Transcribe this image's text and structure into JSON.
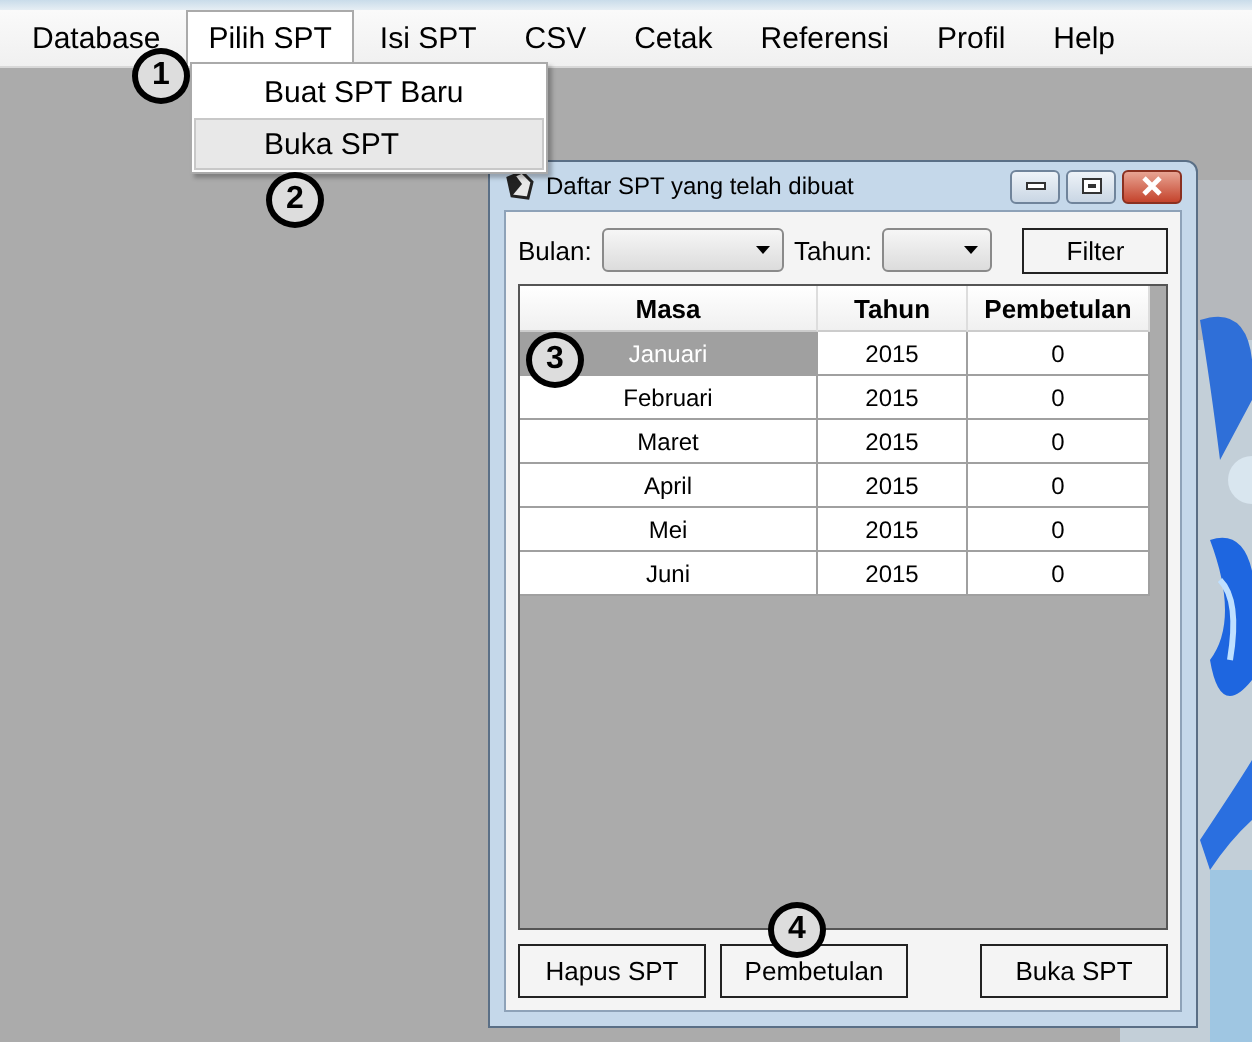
{
  "menu_bar": {
    "items": [
      {
        "label": "Database",
        "selected": false
      },
      {
        "label": "Pilih SPT",
        "selected": true
      },
      {
        "label": "Isi SPT",
        "selected": false
      },
      {
        "label": "CSV",
        "selected": false
      },
      {
        "label": "Cetak",
        "selected": false
      },
      {
        "label": "Referensi",
        "selected": false
      },
      {
        "label": "Profil",
        "selected": false
      },
      {
        "label": "Help",
        "selected": false
      }
    ]
  },
  "dropdown": {
    "items": [
      {
        "label": "Buat SPT Baru",
        "selected": false
      },
      {
        "label": "Buka SPT",
        "selected": true
      }
    ]
  },
  "dialog": {
    "title": "Daftar SPT yang telah dibuat",
    "filters": [
      {
        "label": "Bulan:"
      },
      {
        "label": "Tahun:"
      }
    ],
    "filter_button": "Filter",
    "table": {
      "columns": [
        "Masa",
        "Tahun",
        "Pembetulan"
      ],
      "rows": [
        {
          "cells": [
            "Januari",
            "2015",
            "0"
          ],
          "selected": true
        },
        {
          "cells": [
            "Februari",
            "2015",
            "0"
          ],
          "selected": false
        },
        {
          "cells": [
            "Maret",
            "2015",
            "0"
          ],
          "selected": false
        },
        {
          "cells": [
            "April",
            "2015",
            "0"
          ],
          "selected": false
        },
        {
          "cells": [
            "Mei",
            "2015",
            "0"
          ],
          "selected": false
        },
        {
          "cells": [
            "Juni",
            "2015",
            "0"
          ],
          "selected": false
        }
      ]
    },
    "buttons": [
      "Hapus SPT",
      "Pembetulan",
      "Buka SPT"
    ]
  },
  "annotations": [
    "1",
    "2",
    "3",
    "4"
  ]
}
